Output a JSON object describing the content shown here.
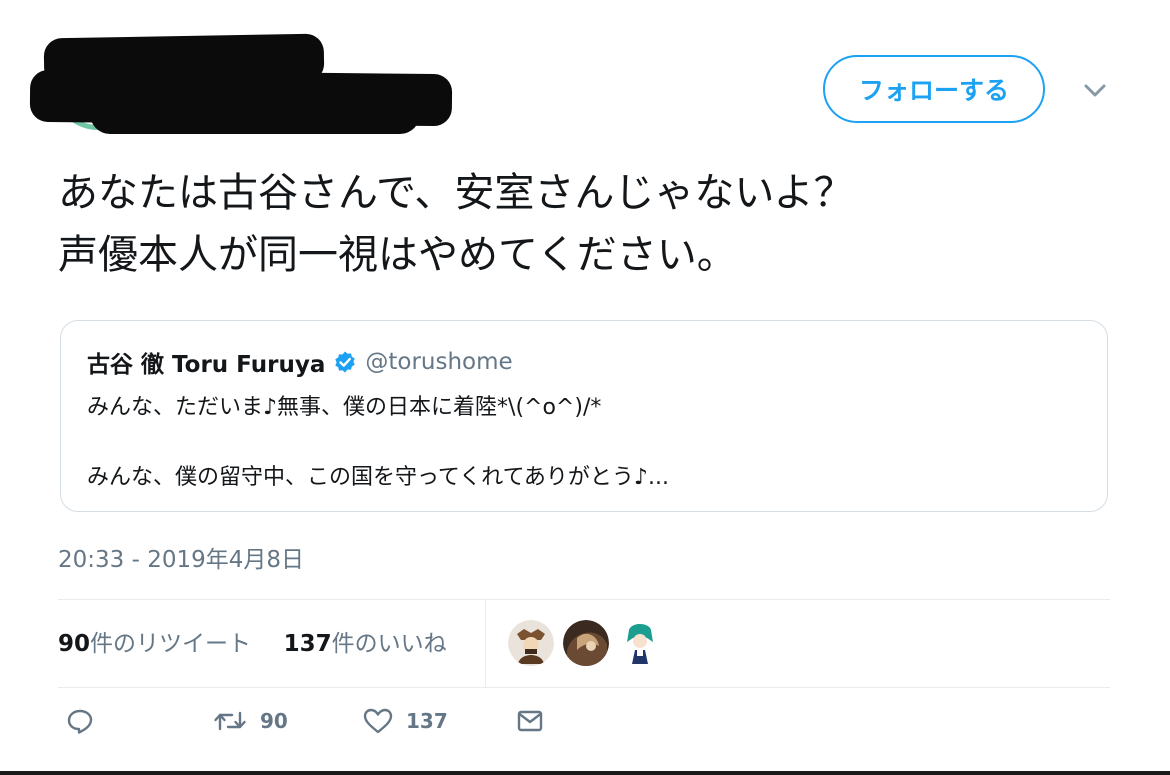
{
  "header": {
    "follow_label": "フォローする"
  },
  "tweet": {
    "text_lines": [
      "あなたは古谷さんで、安室さんじゃないよ？",
      "声優本人が同一視はやめてください。"
    ],
    "timestamp": "20:33 - 2019年4月8日"
  },
  "quote": {
    "name": "古谷 徹 Toru Furuya",
    "handle": "@torushome",
    "lines": [
      "みんな、ただいま♪無事、僕の日本に着陸*\\(^o^)/*",
      "みんな、僕の留守中、この国を守ってくれてありがとう♪..."
    ]
  },
  "stats": {
    "retweets_count": "90",
    "retweets_label": "件のリツイート",
    "likes_count": "137",
    "likes_label": "件のいいね"
  },
  "actions": {
    "retweet_count": "90",
    "like_count": "137"
  },
  "colors": {
    "accent": "#1da1f2",
    "muted": "#657786",
    "avatar_ring": "#6fc7a3"
  },
  "icons": [
    "chevron-down-icon",
    "verified-icon",
    "reply-icon",
    "retweet-icon",
    "like-icon",
    "message-icon"
  ]
}
